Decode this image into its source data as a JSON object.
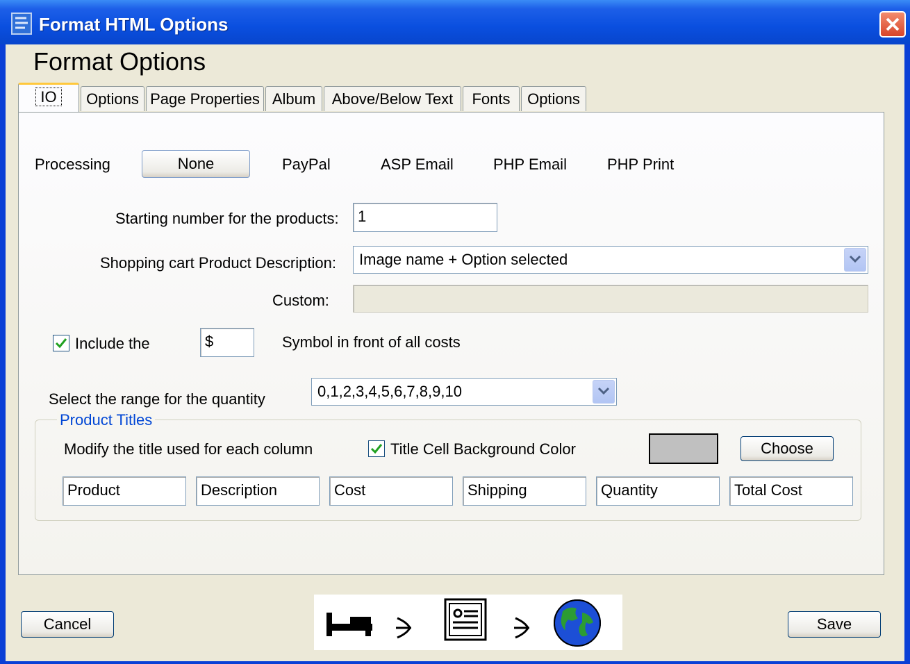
{
  "window": {
    "title": "Format HTML Options"
  },
  "heading": "Format Options",
  "tabs": [
    {
      "label": "IO",
      "active": true
    },
    {
      "label": "Options"
    },
    {
      "label": "Page Properties"
    },
    {
      "label": "Album"
    },
    {
      "label": "Above/Below Text"
    },
    {
      "label": "Fonts"
    },
    {
      "label": "Options"
    }
  ],
  "processing": {
    "label": "Processing",
    "options": [
      "None",
      "PayPal",
      "ASP Email",
      "PHP Email",
      "PHP Print"
    ],
    "selected": "None"
  },
  "starting_number": {
    "label": "Starting number for the products:",
    "value": "1"
  },
  "cart_description": {
    "label": "Shopping cart Product Description:",
    "value": "Image name + Option selected"
  },
  "custom": {
    "label": "Custom:",
    "value": ""
  },
  "currency": {
    "label_before": "Include the",
    "value": "$",
    "label_after": "Symbol in front of all costs",
    "checked": true
  },
  "quantity_range": {
    "label": "Select the range for the quantity",
    "value": "0,1,2,3,4,5,6,7,8,9,10"
  },
  "product_titles": {
    "legend": "Product Titles",
    "modify_label": "Modify the title used for each column",
    "bg_color_label": "Title Cell Background Color",
    "bg_color_checked": true,
    "bg_color": "#c0c0c0",
    "choose_label": "Choose",
    "columns": [
      "Product",
      "Description",
      "Cost",
      "Shipping",
      "Quantity",
      "Total Cost"
    ]
  },
  "footer": {
    "cancel_label": "Cancel",
    "save_label": "Save"
  },
  "toolstrip_icons": [
    "bed-icon",
    "arrow-icon",
    "document-icon",
    "arrow-icon",
    "globe-icon"
  ],
  "colors": {
    "titlebar": "#0a4fdf",
    "accent_tab": "#ffc83c",
    "group_legend": "#0046d5"
  }
}
